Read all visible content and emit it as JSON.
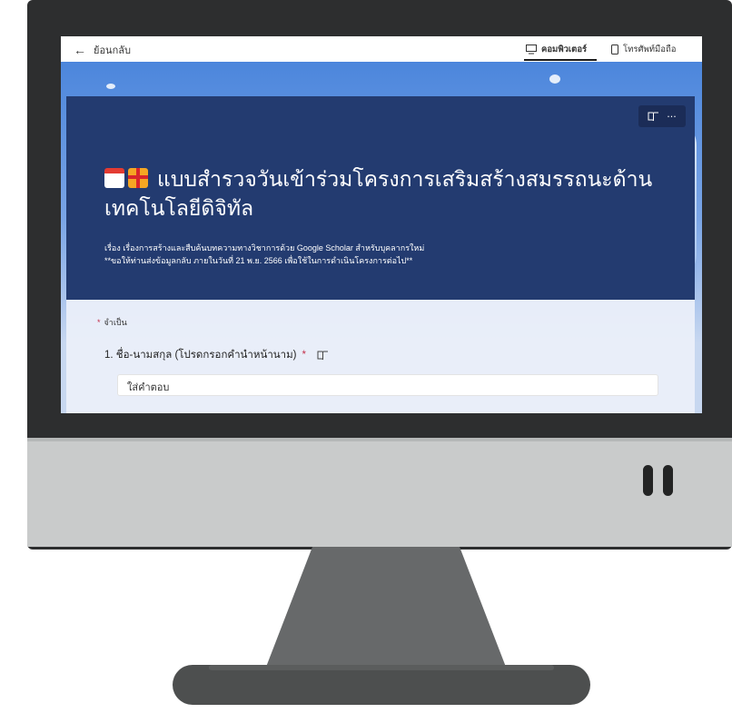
{
  "topbar": {
    "back_label": "ย้อนกลับ",
    "computer_label": "คอมพิวเตอร์",
    "phone_label": "โทรศัพท์มือถือ"
  },
  "form": {
    "title": "แบบสำรวจวันเข้าร่วมโครงการเสริมสร้างสมรรถนะด้านเทคโนโลยีดิจิทัล",
    "description_line1": "เรื่อง เรื่องการสร้างและสืบค้นบทความทางวิชาการด้วย Google Scholar สำหรับบุคลากรใหม่",
    "description_line2": "**ขอให้ท่านส่งข้อมูลกลับ ภายในวันที่ 21 พ.ย. 2566 เพื่อใช้ในการดำเนินโครงการต่อไป**",
    "more_label": "···",
    "required_star": "*",
    "required_label": "จำเป็น",
    "question_1": "1. ชื่อ-นามสกุล (โปรดกรอกคำนำหน้านาม)",
    "answer_placeholder": "ใส่คำตอบ"
  },
  "icons": {
    "back": "arrow-left-icon",
    "computer": "monitor-icon",
    "phone": "phone-icon",
    "immersive_reader": "book-icon",
    "calendar": "calendar-icon",
    "gift": "gift-icon"
  }
}
